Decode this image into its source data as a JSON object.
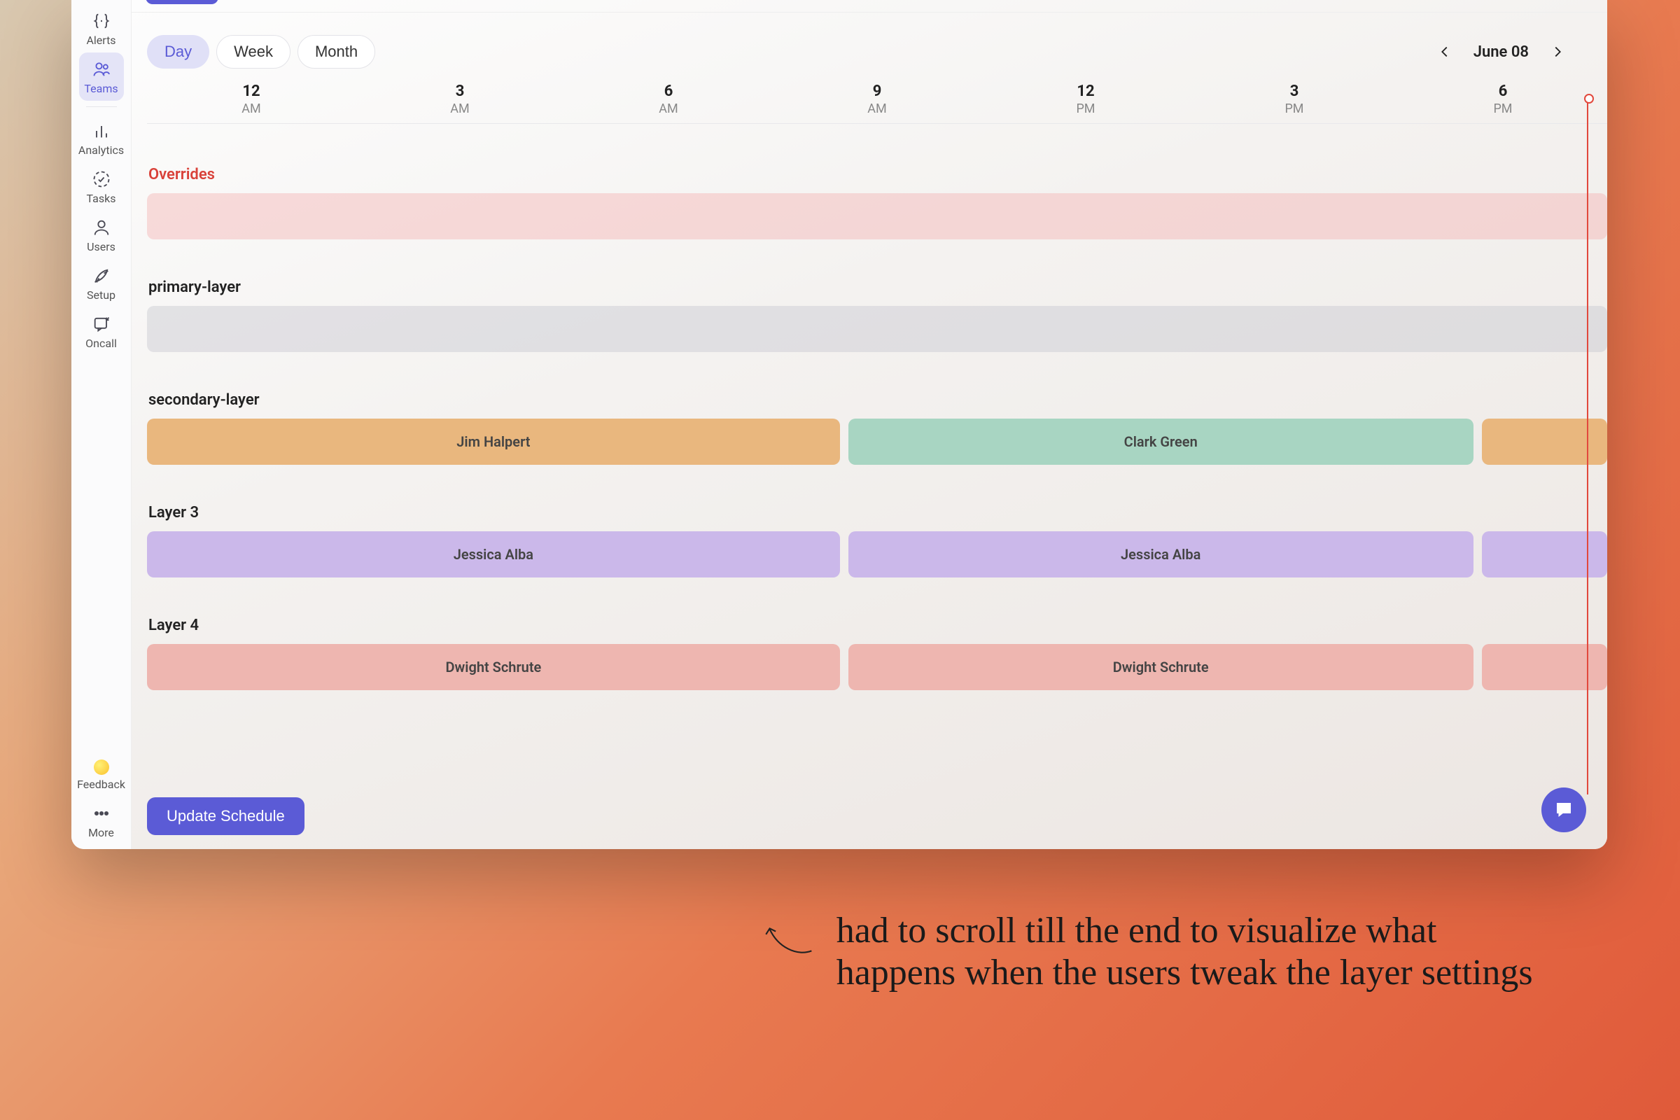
{
  "sidebar": {
    "items": [
      {
        "label": "Alerts"
      },
      {
        "label": "Teams"
      },
      {
        "label": "Analytics"
      },
      {
        "label": "Tasks"
      },
      {
        "label": "Users"
      },
      {
        "label": "Setup"
      },
      {
        "label": "Oncall"
      }
    ],
    "feedback_label": "Feedback",
    "more_label": "More"
  },
  "view_toggle": {
    "day": "Day",
    "week": "Week",
    "month": "Month",
    "active": "Day"
  },
  "date_label": "June 08",
  "time_header": [
    {
      "hour": "12",
      "ampm": "AM"
    },
    {
      "hour": "3",
      "ampm": "AM"
    },
    {
      "hour": "6",
      "ampm": "AM"
    },
    {
      "hour": "9",
      "ampm": "AM"
    },
    {
      "hour": "12",
      "ampm": "PM"
    },
    {
      "hour": "3",
      "ampm": "PM"
    },
    {
      "hour": "6",
      "ampm": "PM"
    }
  ],
  "layers": {
    "overrides": {
      "title": "Overrides"
    },
    "primary": {
      "title": "primary-layer"
    },
    "secondary": {
      "title": "secondary-layer",
      "slots": [
        {
          "name": "Jim Halpert",
          "color": "#e9b77e",
          "width": 48.0
        },
        {
          "name": "Clark Green",
          "color": "#a8d5c2",
          "width": 43.3
        },
        {
          "name": "",
          "color": "#e9b77e",
          "width": 8.7
        }
      ]
    },
    "layer3": {
      "title": "Layer 3",
      "slots": [
        {
          "name": "Jessica Alba",
          "color": "#cbb8ea",
          "width": 48.0
        },
        {
          "name": "Jessica Alba",
          "color": "#cbb8ea",
          "width": 43.3
        },
        {
          "name": "",
          "color": "#cbb8ea",
          "width": 8.7
        }
      ]
    },
    "layer4": {
      "title": "Layer 4",
      "slots": [
        {
          "name": "Dwight Schrute",
          "color": "#eeb6b0",
          "width": 48.0
        },
        {
          "name": "Dwight Schrute",
          "color": "#eeb6b0",
          "width": 43.3
        },
        {
          "name": "",
          "color": "#eeb6b0",
          "width": 8.7
        }
      ]
    }
  },
  "update_button": "Update Schedule",
  "annotation_text": "had to scroll till the end to visualize what happens when the users tweak the layer settings",
  "colors": {
    "accent": "#5b5bd6",
    "danger": "#d9423a"
  }
}
